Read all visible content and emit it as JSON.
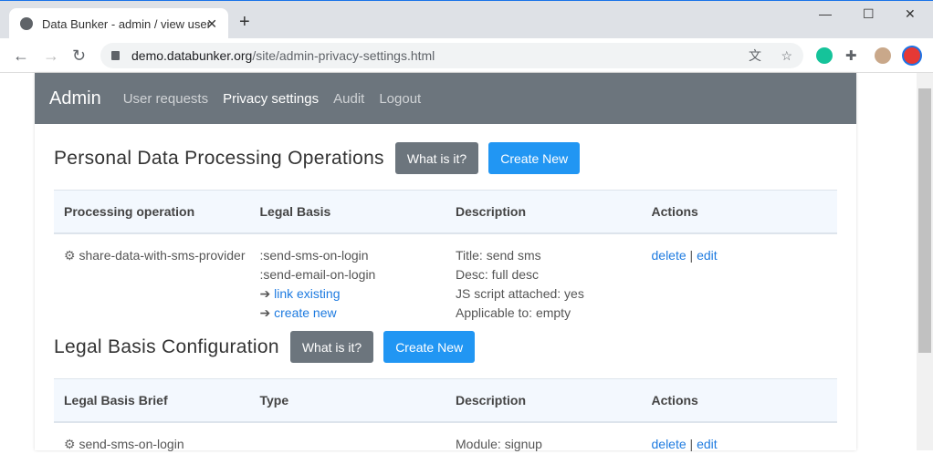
{
  "browser": {
    "tab_title": "Data Bunker - admin / view user",
    "url_host": "demo.databunker.org",
    "url_path": "/site/admin-privacy-settings.html"
  },
  "navbar": {
    "brand": "Admin",
    "links": [
      "User requests",
      "Privacy settings",
      "Audit",
      "Logout"
    ]
  },
  "processing": {
    "title": "Personal Data Processing Operations",
    "what_btn": "What is it?",
    "create_btn": "Create New",
    "headers": [
      "Processing operation",
      "Legal Basis",
      "Description",
      "Actions"
    ],
    "rows": [
      {
        "name": "share-data-with-sms-provider",
        "basis": [
          ":send-sms-on-login",
          ":send-email-on-login"
        ],
        "link_existing": "link existing",
        "create_new": "create new",
        "desc": [
          "Title: send sms",
          "Desc: full desc",
          "JS script attached: yes",
          "Applicable to: empty"
        ],
        "delete": "delete",
        "edit": "edit"
      }
    ]
  },
  "legal": {
    "title": "Legal Basis Configuration",
    "what_btn": "What is it?",
    "create_btn": "Create New",
    "headers": [
      "Legal Basis Brief",
      "Type",
      "Description",
      "Actions"
    ],
    "rows": [
      {
        "brief": "send-sms-on-login",
        "type": "",
        "desc": "Module: signup",
        "delete": "delete",
        "edit": "edit"
      }
    ]
  }
}
